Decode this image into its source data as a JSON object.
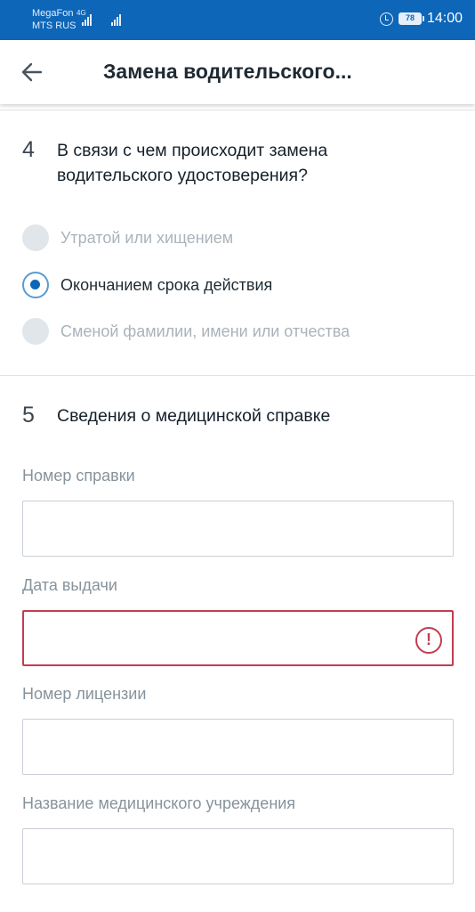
{
  "statusbar": {
    "carrier1": "MegaFon",
    "carrier2": "MTS RUS",
    "network": "4G",
    "battery": "78",
    "time": "14:00"
  },
  "appbar": {
    "title": "Замена водительского...",
    "back_icon": "arrow-left-icon"
  },
  "section4": {
    "number": "4",
    "title_line1": "В связи с чем происходит замена",
    "title_line2": "водительского удостоверения?",
    "options": [
      {
        "label": "Утратой или хищением",
        "selected": false
      },
      {
        "label": "Окончанием срока действия",
        "selected": true
      },
      {
        "label": "Сменой фамилии, имени или отчества",
        "selected": false
      }
    ]
  },
  "section5": {
    "number": "5",
    "title": "Сведения о медицинской справке",
    "fields": [
      {
        "label": "Номер справки",
        "value": "",
        "error": false
      },
      {
        "label": "Дата выдачи",
        "value": "",
        "error": true
      },
      {
        "label": "Номер лицензии",
        "value": "",
        "error": false
      },
      {
        "label": "Название медицинского учреждения",
        "value": "",
        "error": false
      }
    ],
    "error_icon": "exclamation-circle-icon"
  },
  "colors": {
    "primary": "#0d66b8",
    "error": "#c23d52",
    "radio_ring": "#5b9bd1"
  }
}
